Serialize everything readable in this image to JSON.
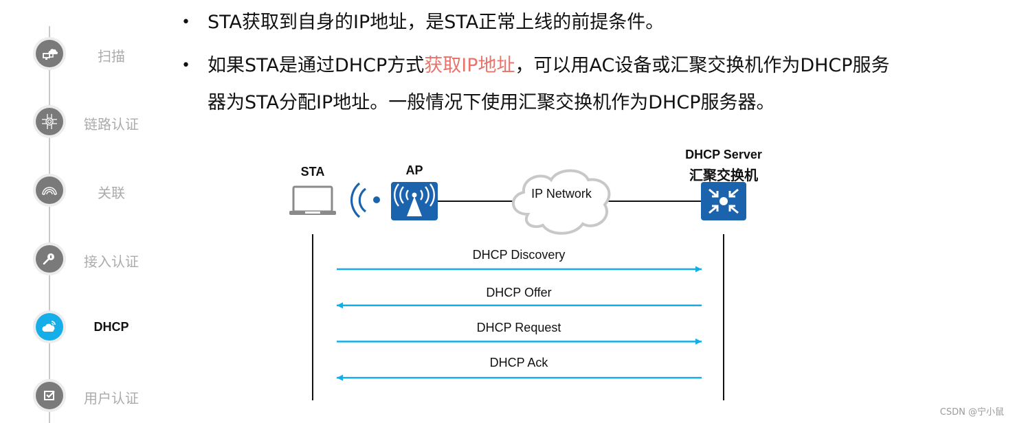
{
  "sidebar": {
    "steps": [
      {
        "label": "扫描",
        "icon": "network-cloud-icon",
        "active": false
      },
      {
        "label": "链路认证",
        "icon": "roundabout-icon",
        "active": false
      },
      {
        "label": "关联",
        "icon": "rainbow-arc-icon",
        "active": false
      },
      {
        "label": "接入认证",
        "icon": "key-icon",
        "active": false
      },
      {
        "label": "DHCP",
        "icon": "wireless-cloud-icon",
        "active": true
      },
      {
        "label": "用户认证",
        "icon": "checkbox-icon",
        "active": false
      }
    ],
    "active_color": "#15aee8",
    "inactive_color": "#7a7a7a"
  },
  "bullets": [
    {
      "text_before": "STA获取到自身的IP地址，是STA正常上线的前提条件。",
      "highlight": "",
      "text_after": ""
    },
    {
      "line1_before": "如果STA是通过DHCP方式",
      "highlight": "获取IP地址",
      "line1_after": "，可以用AC设备或汇聚交换机作为DHCP服务",
      "line2": "器为STA分配IP地址。一般情况下使用汇聚交换机作为DHCP服务器。"
    }
  ],
  "highlight_color": "#e8736b",
  "diagram": {
    "nodes": {
      "sta": {
        "label": "STA",
        "icon": "laptop-icon"
      },
      "ap": {
        "label": "AP",
        "icon": "access-point-icon"
      },
      "network": {
        "label": "IP Network",
        "icon": "cloud-icon"
      },
      "server": {
        "label_line1": "DHCP Server",
        "label_line2": "汇聚交换机",
        "icon": "aggregation-switch-icon"
      }
    },
    "messages": [
      {
        "label": "DHCP Discovery",
        "direction": "to-server"
      },
      {
        "label": "DHCP Offer",
        "direction": "to-sta"
      },
      {
        "label": "DHCP Request",
        "direction": "to-server"
      },
      {
        "label": "DHCP Ack",
        "direction": "to-sta"
      }
    ],
    "arrow_color": "#14aee6",
    "device_color": "#1b63ad"
  },
  "watermark": "CSDN @宁小鼠"
}
